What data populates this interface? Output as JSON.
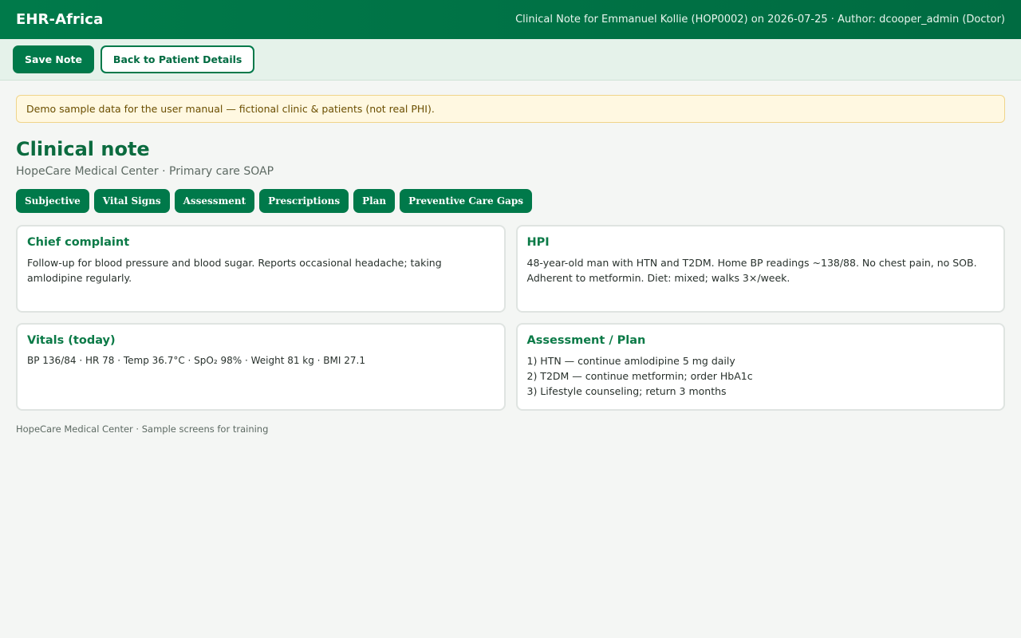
{
  "app": {
    "brand": "EHR-Africa",
    "context": "Clinical Note for Emmanuel Kollie (HOP0002) on 2026-07-25 · Author: dcooper_admin (Doctor)"
  },
  "toolbar": {
    "save_label": "Save Note",
    "back_label": "Back to Patient Details"
  },
  "banner": {
    "text": "Demo sample data for the user manual — fictional clinic & patients (not real PHI)."
  },
  "page": {
    "title": "Clinical note",
    "subtitle": "HopeCare Medical Center · Primary care SOAP"
  },
  "tabs": [
    {
      "label": "Subjective"
    },
    {
      "label": "Vital Signs"
    },
    {
      "label": "Assessment"
    },
    {
      "label": "Prescriptions"
    },
    {
      "label": "Plan"
    },
    {
      "label": "Preventive Care Gaps"
    }
  ],
  "cards": {
    "chief_complaint": {
      "title": "Chief complaint",
      "text": "Follow-up for blood pressure and blood sugar. Reports occasional headache; taking amlodipine regularly."
    },
    "hpi": {
      "title": "HPI",
      "text": "48-year-old man with HTN and T2DM. Home BP readings ~138/88. No chest pain, no SOB. Adherent to metformin. Diet: mixed; walks 3×/week."
    },
    "vitals": {
      "title": "Vitals (today)",
      "text": "BP 136/84 · HR 78 · Temp 36.7°C · SpO₂ 98% · Weight 81 kg · BMI 27.1"
    },
    "assessment_plan": {
      "title": "Assessment / Plan",
      "lines": [
        "1) HTN — continue amlodipine 5 mg daily",
        "2) T2DM — continue metformin; order HbA1c",
        "3) Lifestyle counseling; return 3 months"
      ]
    }
  },
  "footer": {
    "text": "HopeCare Medical Center · Sample screens for training"
  },
  "colors": {
    "primary": "#00794a",
    "heading": "#0b6b3f",
    "banner_bg": "#fff8e1"
  }
}
